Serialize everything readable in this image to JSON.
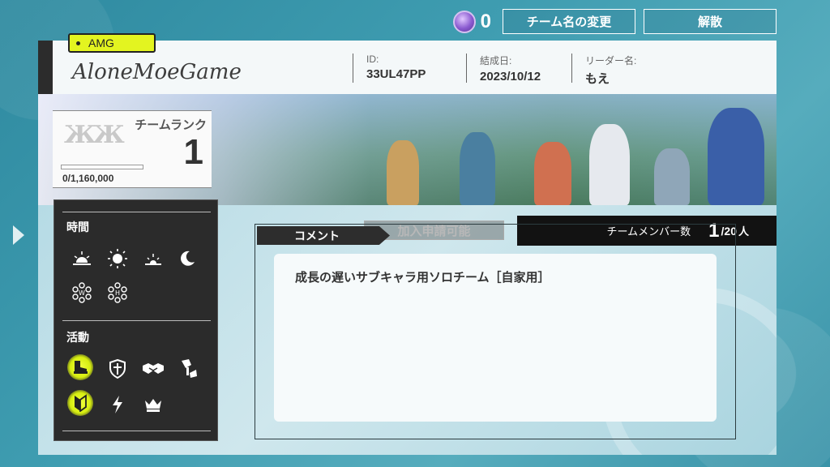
{
  "topbar": {
    "crystal_icon": "crystal-icon",
    "crystal_count": "0",
    "rename_label": "チーム名の変更",
    "disband_label": "解散"
  },
  "team": {
    "tag": "AMG",
    "name": "AloneMoeGame",
    "id_label": "ID:",
    "id_value": "33UL47PP",
    "date_label": "結成日:",
    "date_value": "2023/10/12",
    "leader_label": "リーダー名:",
    "leader_value": "もえ"
  },
  "rank": {
    "label": "チームランク",
    "value": "1",
    "points": "0/1,160,000",
    "progress": 0.0
  },
  "banner": {
    "join_label": "加入申請可能",
    "member_label": "チームメンバー数",
    "member_count": "1",
    "member_max": "/20",
    "member_unit": "人"
  },
  "sidebar": {
    "time_title": "時間",
    "time_icons": [
      "sunrise-icon",
      "sun-icon",
      "sunset-icon",
      "moon-icon",
      "weekday-icon",
      "holiday-icon"
    ],
    "activity_title": "活動",
    "activity_icons": [
      {
        "name": "boot-icon",
        "active": true
      },
      {
        "name": "shield-icon",
        "active": false
      },
      {
        "name": "handshake-icon",
        "active": false
      },
      {
        "name": "harvest-icon",
        "active": false
      },
      {
        "name": "beginner-mark-icon",
        "active": true
      },
      {
        "name": "lightning-icon",
        "active": false
      },
      {
        "name": "crown-icon",
        "active": false
      }
    ]
  },
  "comment": {
    "title": "コメント",
    "text": "成長の遅いサブキャラ用ソロチーム［自家用］"
  },
  "colors": {
    "accent": "#e3f420",
    "background": "#3f9db1",
    "dark": "#2b2b2b"
  }
}
